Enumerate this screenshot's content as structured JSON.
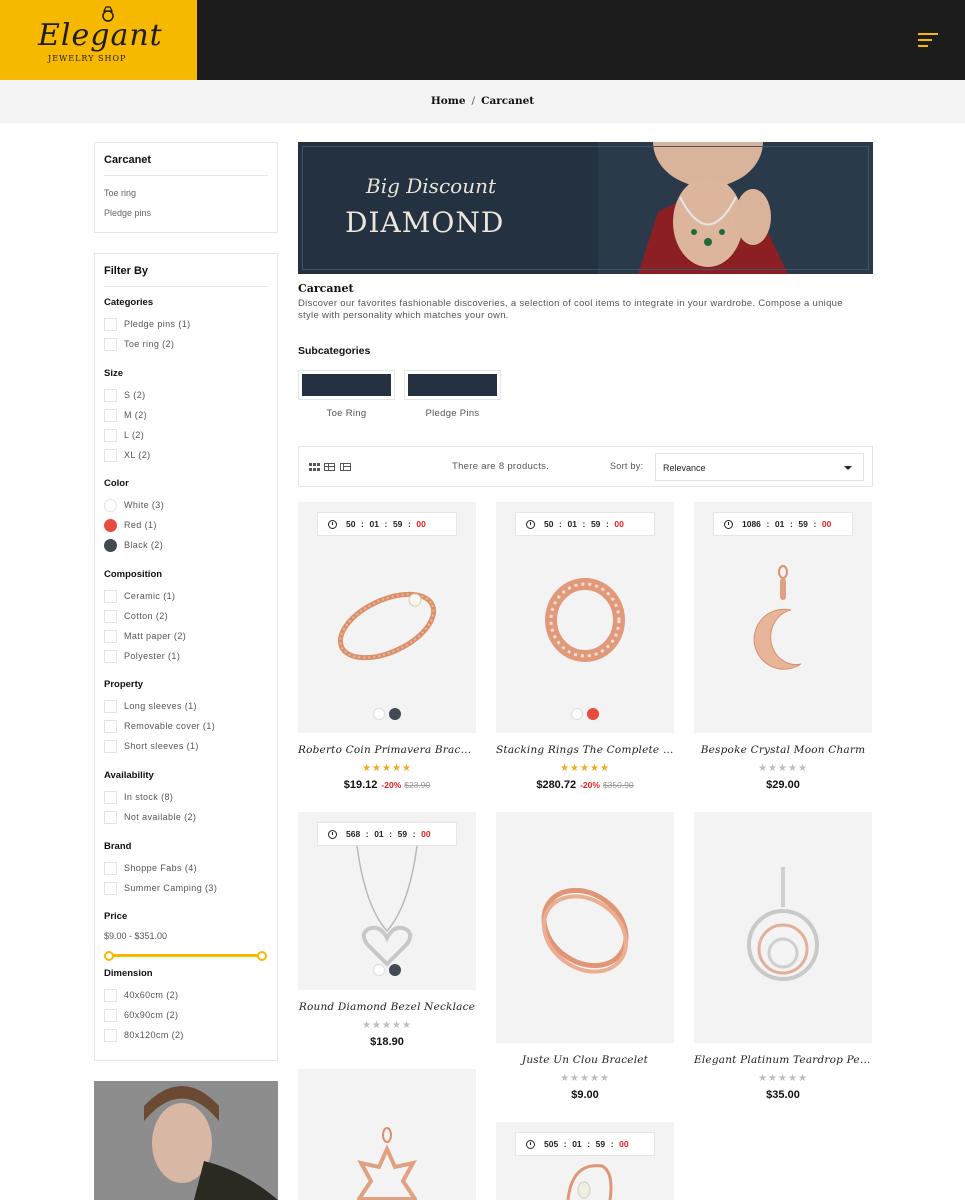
{
  "header": {
    "logo_script": "Elegant",
    "logo_sub": "JEWELRY SHOP"
  },
  "breadcrumb": {
    "home": "Home",
    "sep": "/",
    "current": "Carcanet"
  },
  "sidebar": {
    "category_box": {
      "title": "Carcanet",
      "links": [
        "Toe ring",
        "Pledge pins"
      ]
    },
    "filter_title": "Filter By",
    "facets": {
      "categories": {
        "title": "Categories",
        "options": [
          "Pledge pins (1)",
          "Toe ring (2)"
        ]
      },
      "size": {
        "title": "Size",
        "options": [
          "S (2)",
          "M (2)",
          "L (2)",
          "XL (2)"
        ]
      },
      "color": {
        "title": "Color",
        "options": [
          {
            "label": "White (3)",
            "color": "#ffffff"
          },
          {
            "label": "Red (1)",
            "color": "#e84c3d"
          },
          {
            "label": "Black (2)",
            "color": "#434a54"
          }
        ]
      },
      "composition": {
        "title": "Composition",
        "options": [
          "Ceramic (1)",
          "Cotton (2)",
          "Matt paper (2)",
          "Polyester (1)"
        ]
      },
      "property": {
        "title": "Property",
        "options": [
          "Long sleeves (1)",
          "Removable cover (1)",
          "Short sleeves (1)"
        ]
      },
      "availability": {
        "title": "Availability",
        "options": [
          "In stock (8)",
          "Not available (2)"
        ]
      },
      "brand": {
        "title": "Brand",
        "options": [
          "Shoppe Fabs (4)",
          "Summer Camping (3)"
        ]
      },
      "price": {
        "title": "Price",
        "range_label": "$9.00 - $351.00"
      },
      "dimension": {
        "title": "Dimension",
        "options": [
          "40x60cm (2)",
          "60x90cm (2)",
          "80x120cm (2)"
        ]
      }
    }
  },
  "main": {
    "banner": {
      "script": "Big Discount",
      "title": "DIAMOND"
    },
    "category_title": "Carcanet",
    "category_description": "Discover our favorites fashionable discoveries, a selection of cool items to integrate in your wardrobe. Compose a unique style with personality which matches your own.",
    "subcategories_heading": "Subcategories",
    "subcategories": [
      "Toe Ring",
      "Pledge Pins"
    ],
    "toolbar": {
      "count_text": "There are 8 products.",
      "sort_label": "Sort by:",
      "sort_value": "Relevance"
    },
    "products": [
      {
        "name": "Roberto Coin Primavera Bracel...",
        "timer": [
          "50",
          "01",
          "59",
          "00"
        ],
        "price": "$19.12",
        "discount": "-20%",
        "old_price": "$23.90",
        "rating_on": true,
        "colors": [
          "#ffffff",
          "#434a54"
        ]
      },
      {
        "name": "Stacking Rings The Complete G...",
        "timer": [
          "50",
          "01",
          "59",
          "00"
        ],
        "price": "$280.72",
        "discount": "-20%",
        "old_price": "$350.90",
        "rating_on": true,
        "colors": [
          "#ffffff",
          "#e84c3d"
        ]
      },
      {
        "name": "Bespoke Crystal Moon Charm",
        "timer": [
          "1086",
          "01",
          "59",
          "00"
        ],
        "price": "$29.00",
        "rating_on": false
      },
      {
        "name": "Round Diamond Bezel Necklace",
        "timer": [
          "568",
          "01",
          "59",
          "00"
        ],
        "price": "$18.90",
        "rating_on": false,
        "colors": [
          "#ffffff",
          "#434a54"
        ]
      },
      {
        "name": "Juste Un Clou Bracelet",
        "price": "$9.00",
        "rating_on": false
      },
      {
        "name": "Elegant Platinum Teardrop Pen...",
        "price": "$35.00",
        "rating_on": false
      },
      {
        "name": "",
        "price": ""
      },
      {
        "name": "",
        "timer": [
          "505",
          "01",
          "59",
          "00"
        ],
        "price": ""
      }
    ],
    "stars": "★★★★★",
    "accent_color": "#f7b900"
  }
}
